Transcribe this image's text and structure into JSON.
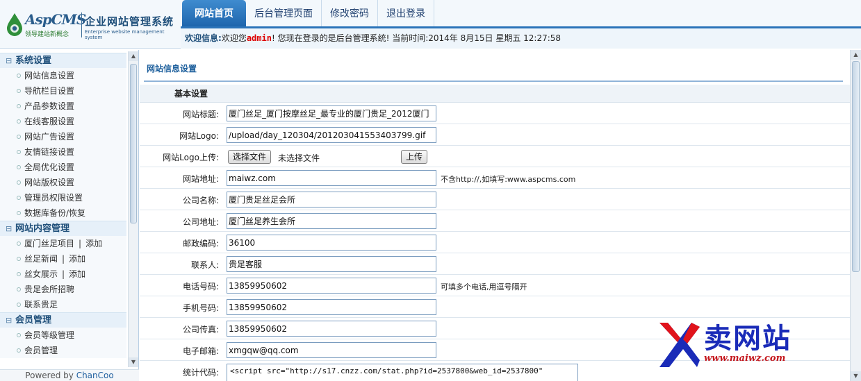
{
  "header": {
    "logo_brand": "AspCMS",
    "logo_slogan": "领导建站新概念",
    "logo_title_cn": "企业网站管理系统",
    "logo_title_en": "Enterprise website management system"
  },
  "nav": {
    "tabs": [
      {
        "label": "网站首页"
      },
      {
        "label": "后台管理页面"
      },
      {
        "label": "修改密码"
      },
      {
        "label": "退出登录"
      }
    ]
  },
  "welcome": {
    "label": "欢迎信息:",
    "prefix": "欢迎您",
    "username": "admin",
    "suffix": "! 您现在登录的是后台管理系统! 当前时间:2014年 8月15日 星期五 12:27:58"
  },
  "sidebar": {
    "groups": [
      {
        "title": "系统设置",
        "toggle": "⊟",
        "items": [
          {
            "label": "网站信息设置"
          },
          {
            "label": "导航栏目设置"
          },
          {
            "label": "产品参数设置"
          },
          {
            "label": "在线客服设置"
          },
          {
            "label": "网站广告设置"
          },
          {
            "label": "友情链接设置"
          },
          {
            "label": "全局优化设置"
          },
          {
            "label": "网站版权设置"
          },
          {
            "label": "管理员权限设置"
          },
          {
            "label": "数据库备份/恢复"
          }
        ]
      },
      {
        "title": "网站内容管理",
        "toggle": "⊟",
        "items": [
          {
            "label": "厦门丝足项目",
            "pipe": "|",
            "add": "添加"
          },
          {
            "label": "丝足新闻",
            "pipe": "|",
            "add": "添加"
          },
          {
            "label": "丝女展示",
            "pipe": "|",
            "add": "添加"
          },
          {
            "label": "贵足会所招聘"
          },
          {
            "label": "联系贵足"
          }
        ]
      },
      {
        "title": "会员管理",
        "toggle": "⊟",
        "items": [
          {
            "label": "会员等级管理"
          },
          {
            "label": "会员管理"
          }
        ]
      }
    ],
    "powered_prefix": "Powered by",
    "powered_link": "ChanCoo"
  },
  "main": {
    "page_title": "网站信息设置",
    "section_title": "基本设置",
    "fields": {
      "site_title": {
        "label": "网站标题:",
        "value": "厦门丝足_厦门按摩丝足_最专业的厦门贵足_2012厦门"
      },
      "site_logo": {
        "label": "网站Logo:",
        "value": "/upload/day_120304/201203041553403799.gif"
      },
      "logo_upload": {
        "label": "网站Logo上传:",
        "choose": "选择文件",
        "no_file": "未选择文件",
        "upload": "上传"
      },
      "site_url": {
        "label": "网站地址:",
        "value": "maiwz.com",
        "hint": "不含http://,如填写:www.aspcms.com"
      },
      "company_name": {
        "label": "公司名称:",
        "value": "厦门贵足丝足会所"
      },
      "company_address": {
        "label": "公司地址:",
        "value": "厦门丝足养生会所"
      },
      "postcode": {
        "label": "邮政编码:",
        "value": "36100"
      },
      "contact": {
        "label": "联系人:",
        "value": "贵足客服"
      },
      "phone": {
        "label": "电话号码:",
        "value": "13859950602",
        "hint": "可填多个电话,用逗号隔开"
      },
      "mobile": {
        "label": "手机号码:",
        "value": "13859950602"
      },
      "fax": {
        "label": "公司传真:",
        "value": "13859950602"
      },
      "email": {
        "label": "电子邮箱:",
        "value": "xmgqw@qq.com"
      },
      "stats_code": {
        "label": "统计代码:",
        "value": "<script src=\"http://s17.cnzz.com/stat.php?id=2537800&web_id=2537800\""
      }
    }
  },
  "watermark": {
    "text_cn": "卖网站",
    "url": "www.maiwz.com"
  },
  "colors": {
    "nav_active": "#2a73b8",
    "accent": "#1d5f9c",
    "username": "#dd0000",
    "watermark_blue": "#1a2bb8",
    "watermark_red": "#c4161c"
  }
}
